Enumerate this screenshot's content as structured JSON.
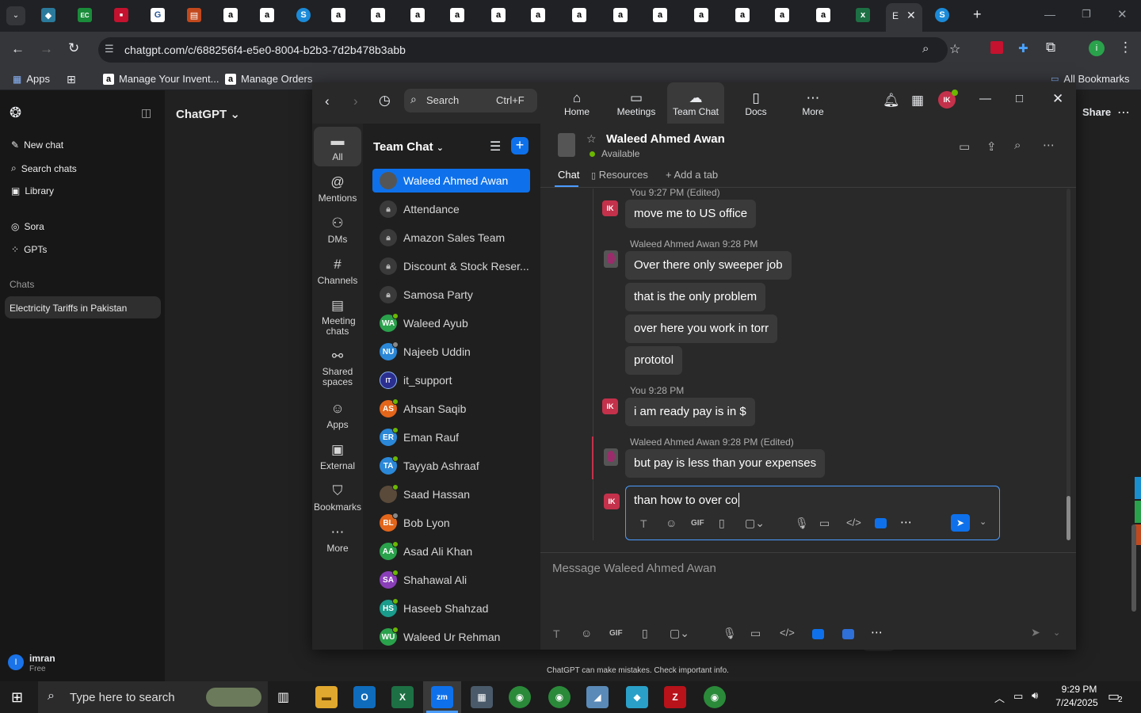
{
  "browser": {
    "url": "chatgpt.com/c/688256f4-e5e0-8004-b2b3-7d2b478b3abb",
    "bookmarks": {
      "apps": "Apps",
      "b1": "Manage Your Invent...",
      "b2": "Manage Orders",
      "all": "All Bookmarks"
    }
  },
  "chatgpt": {
    "header": "ChatGPT",
    "new_chat": "New chat",
    "search": "Search chats",
    "library": "Library",
    "sora": "Sora",
    "gpts": "GPTs",
    "chats_heading": "Chats",
    "chat1": "Electricity Tariffs in Pakistan",
    "share": "Share",
    "user_name": "imran",
    "user_plan": "Free",
    "user_initial": "I",
    "footer_note": "ChatGPT can make mistakes. Check important info."
  },
  "teams": {
    "search_placeholder": "Search",
    "search_shortcut": "Ctrl+F",
    "nav": [
      "Home",
      "Meetings",
      "Team Chat",
      "Docs",
      "More"
    ],
    "user_initials": "IK",
    "rail": [
      "All",
      "Mentions",
      "DMs",
      "Channels",
      "Meeting chats",
      "Shared spaces",
      "Apps",
      "External",
      "Bookmarks",
      "More"
    ],
    "list_title": "Team Chat",
    "contacts": [
      {
        "name": "Waleed Ahmed Awan"
      },
      {
        "name": "Attendance"
      },
      {
        "name": "Amazon Sales Team"
      },
      {
        "name": "Discount & Stock Reser..."
      },
      {
        "name": "Samosa Party"
      },
      {
        "name": "Waleed Ayub",
        "initials": "WA",
        "color": "#2aa24c"
      },
      {
        "name": "Najeeb Uddin",
        "initials": "NU",
        "color": "#2b88d8"
      },
      {
        "name": "it_support",
        "initials": "IT",
        "color": "#2b2f8f"
      },
      {
        "name": "Ahsan Saqib",
        "initials": "AS",
        "color": "#e3661b"
      },
      {
        "name": "Eman Rauf",
        "initials": "ER",
        "color": "#2b88d8"
      },
      {
        "name": "Tayyab Ashraaf",
        "initials": "TA",
        "color": "#2b88d8"
      },
      {
        "name": "Saad Hassan",
        "initials": "",
        "color": "#5a4a3a"
      },
      {
        "name": "Bob Lyon",
        "initials": "BL",
        "color": "#e3661b"
      },
      {
        "name": "Asad Ali Khan",
        "initials": "AA",
        "color": "#2aa24c"
      },
      {
        "name": "Shahawal Ali",
        "initials": "SA",
        "color": "#8a3fb8"
      },
      {
        "name": "Haseeb Shahzad",
        "initials": "HS",
        "color": "#1a9c8c"
      },
      {
        "name": "Waleed Ur Rehman",
        "initials": "WU",
        "color": "#2aa24c"
      }
    ],
    "chat": {
      "name": "Waleed Ahmed Awan",
      "status": "Available",
      "tabs": [
        "Chat",
        "Resources",
        "Add a tab"
      ],
      "meta1": "You 9:27 PM (Edited)",
      "m1": "move me to US office",
      "meta2": "Waleed Ahmed Awan 9:28 PM",
      "m2": "Over there only sweeper job",
      "m3": "that is the only problem",
      "m4": "over here you work in torr",
      "m5": "prototol",
      "meta3": "You 9:28 PM",
      "m6": "i am ready pay is in $",
      "meta4": "Waleed Ahmed Awan 9:28 PM (Edited)",
      "m7": "but pay is less than your expenses",
      "edit_text": "than how to over co",
      "compose_placeholder": "Message Waleed Ahmed Awan"
    }
  },
  "taskbar": {
    "search": "Type here to search",
    "time": "9:29 PM",
    "date": "7/24/2025",
    "notif": "2"
  }
}
